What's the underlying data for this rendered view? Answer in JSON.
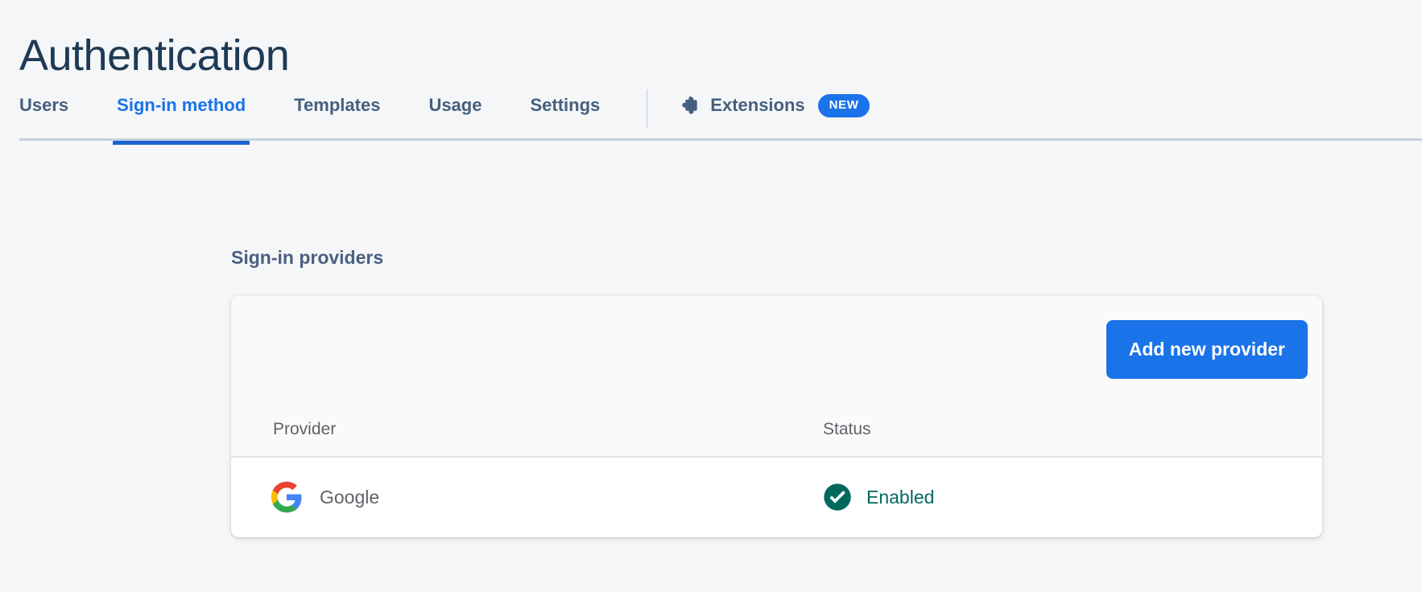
{
  "page": {
    "title": "Authentication"
  },
  "tabs": [
    {
      "id": "users",
      "label": "Users",
      "active": false
    },
    {
      "id": "sign-in-method",
      "label": "Sign-in method",
      "active": true
    },
    {
      "id": "templates",
      "label": "Templates",
      "active": false
    },
    {
      "id": "usage",
      "label": "Usage",
      "active": false
    },
    {
      "id": "settings",
      "label": "Settings",
      "active": false
    }
  ],
  "extensions_tab": {
    "label": "Extensions",
    "icon": "puzzle-piece-icon",
    "badge": "NEW"
  },
  "section": {
    "heading": "Sign-in providers"
  },
  "card": {
    "add_provider_button": "Add new provider",
    "table": {
      "columns": [
        "Provider",
        "Status"
      ],
      "rows": [
        {
          "provider": "Google",
          "provider_icon": "google-logo-icon",
          "status": "Enabled",
          "status_icon": "check-circle-icon"
        }
      ]
    }
  },
  "colors": {
    "page_background": "#f5f6f8",
    "title": "#1e3a54",
    "tab_inactive": "#45607e",
    "tab_active": "#1a73e8",
    "accent_blue": "#1a73e8",
    "status_enabled": "#00695c",
    "card_background": "#ffffff",
    "card_header_background": "#fafafa",
    "divider": "#c5d0de"
  }
}
